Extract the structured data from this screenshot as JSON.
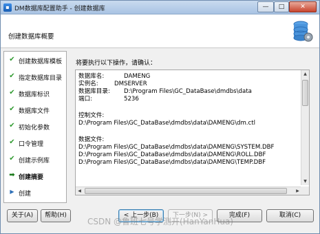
{
  "window": {
    "title": "DM数据库配置助手 - 创建数据库",
    "controls": {
      "minimize": "—",
      "maximize": "□",
      "close": "✕"
    }
  },
  "header": {
    "page_title": "创建数据库概要"
  },
  "sidebar": {
    "steps": [
      {
        "label": "创建数据库模板",
        "state": "done"
      },
      {
        "label": "指定数据库目录",
        "state": "done"
      },
      {
        "label": "数据库标识",
        "state": "done"
      },
      {
        "label": "数据库文件",
        "state": "done"
      },
      {
        "label": "初始化参数",
        "state": "done"
      },
      {
        "label": "口令管理",
        "state": "done"
      },
      {
        "label": "创建示例库",
        "state": "done"
      },
      {
        "label": "创建摘要",
        "state": "current"
      },
      {
        "label": "创建",
        "state": "pending"
      }
    ],
    "markers": {
      "done": "✔",
      "current": "➡",
      "pending": "▶"
    }
  },
  "main": {
    "intro": "将要执行以下操作，请确认：",
    "summary": {
      "fields": [
        {
          "key": "数据库名:",
          "value": "DAMENG"
        },
        {
          "key": "实例名:",
          "value": "DMSERVER"
        },
        {
          "key": "数据库目录:",
          "value": "D:\\Program Files\\GC_DataBase\\dmdbs\\data"
        },
        {
          "key": "端口:",
          "value": "5236"
        }
      ],
      "control_file_label": "控制文件:",
      "control_file": "D:\\Program Files\\GC_DataBase\\dmdbs\\data\\DAMENG\\dm.ctl",
      "data_files_label": "数据文件:",
      "data_files": [
        "D:\\Program Files\\GC_DataBase\\dmdbs\\data\\DAMENG\\SYSTEM.DBF",
        "D:\\Program Files\\GC_DataBase\\dmdbs\\data\\DAMENG\\ROLL.DBF",
        "D:\\Program Files\\GC_DataBase\\dmdbs\\data\\DAMENG\\TEMP.DBF"
      ]
    }
  },
  "buttons": {
    "about": "关于(A)",
    "help": "帮助(H)",
    "prev": "< 上一步(B)",
    "next": "下一步(N) >",
    "finish": "完成(F)",
    "cancel": "取消(C)"
  },
  "watermark": "CSDN @鲁班七号学测开(HanYanHua)"
}
